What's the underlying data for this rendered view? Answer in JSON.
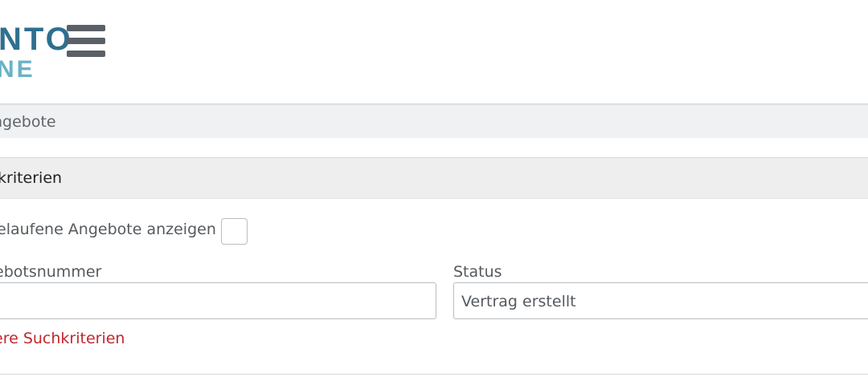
{
  "header": {
    "logo_line1": "NTO",
    "logo_line2": "NE",
    "menu_icon": "hamburger-menu-icon"
  },
  "breadcrumb": {
    "text": "ngebote"
  },
  "search_panel": {
    "title": "kriterien",
    "expired_label": "elaufene Angebote anzeigen",
    "expired_checked": false,
    "offer_number_label": "ebotsnummer",
    "offer_number_value": "",
    "status_label": "Status",
    "status_value": "Vertrag erstellt",
    "more_criteria_link": "ere Suchkriterien"
  },
  "colors": {
    "logo_dark": "#2f6f8f",
    "logo_light": "#6ab3c6",
    "link_red": "#c0282d",
    "bar_bg": "#eff1f3"
  }
}
